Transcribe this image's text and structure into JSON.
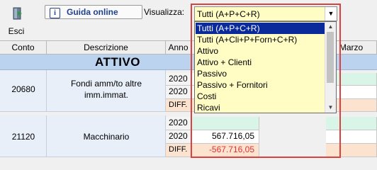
{
  "toolbar": {
    "exit_label": "Esci",
    "help_label": "Guida online",
    "help_icon": "i",
    "view_label": "Visualizza:"
  },
  "view_select": {
    "selected": "Tutti (A+P+C+R)",
    "options": [
      "Tutti (A+P+C+R)",
      "Tutti (A+Cli+P+Forn+C+R)",
      "Attivo",
      "Attivo + Clienti",
      "Passivo",
      "Passivo + Fornitori",
      "Costi",
      "Ricavi"
    ]
  },
  "grid": {
    "headers": {
      "conto": "Conto",
      "descrizione": "Descrizione",
      "anno": "Anno",
      "marzo": "Marzo"
    },
    "section_title": "ATTIVO",
    "rows": [
      {
        "conto": "20680",
        "descrizione": "Fondi amm/to altre imm.immat.",
        "year1": "2020",
        "year2": "2020",
        "diff_label": "DIFF.",
        "value2": "",
        "diff_value": ""
      },
      {
        "conto": "21120",
        "descrizione": "Macchinario",
        "year1": "2020",
        "year2": "2020",
        "diff_label": "DIFF.",
        "value2": "567.716,05",
        "diff_value": "-567.716,05"
      }
    ]
  },
  "colors": {
    "selection": "#0a2a9b",
    "highlight_frame": "#d9423f",
    "combo_bg": "#fffdc4",
    "negative": "#e03030",
    "section_bg": "#bcd3ef"
  }
}
